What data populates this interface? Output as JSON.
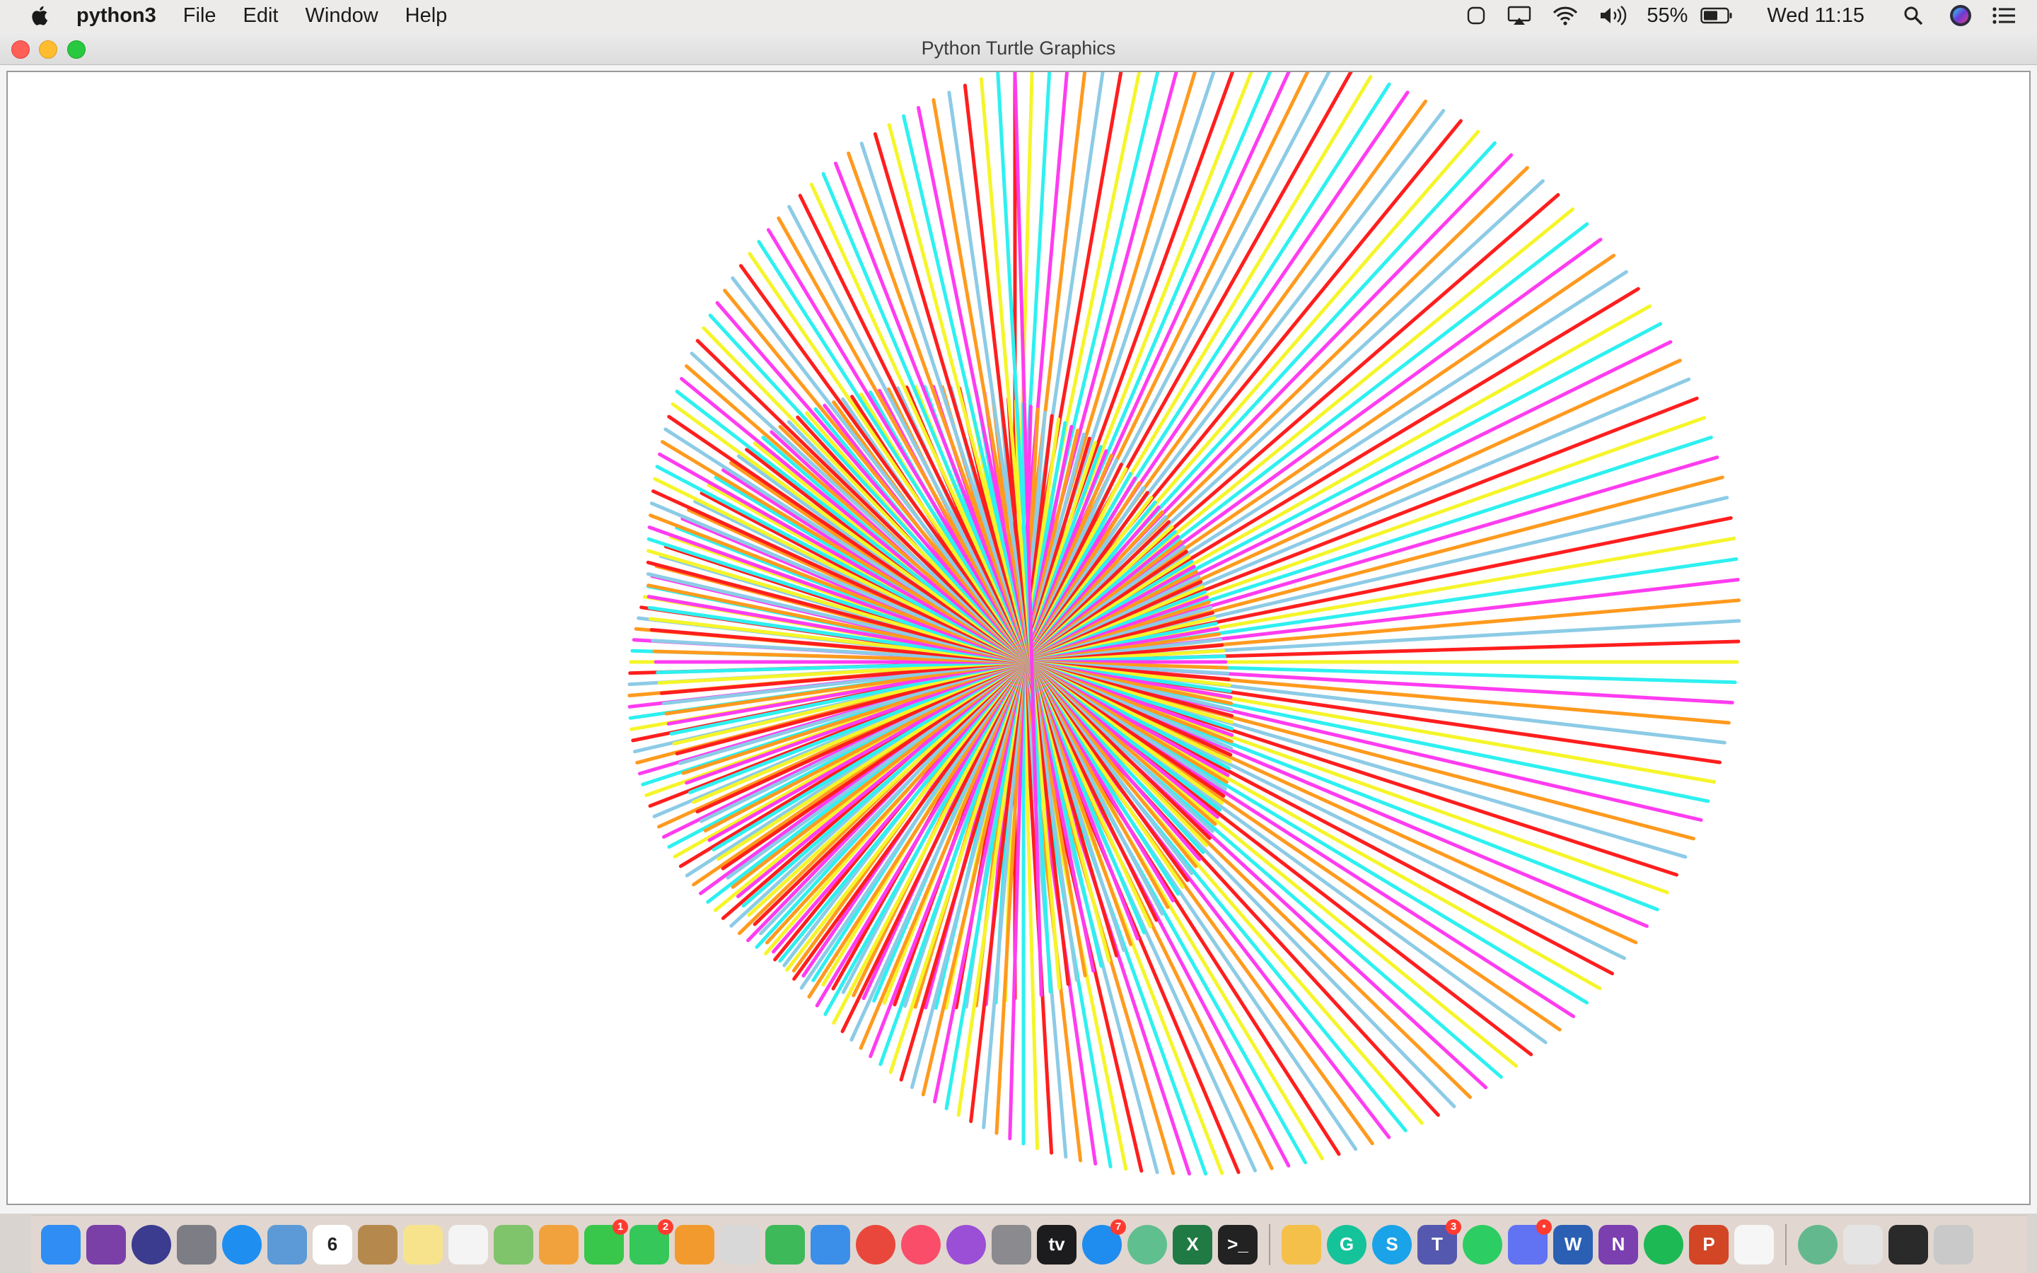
{
  "menubar": {
    "app_name": "python3",
    "menus": [
      "File",
      "Edit",
      "Window",
      "Help"
    ],
    "battery_percent": "55%",
    "clock": "Wed 11:15",
    "status_icons": [
      "screen-record-icon",
      "airplay-icon",
      "wifi-icon",
      "volume-icon",
      "battery-icon",
      "spotlight-search-icon",
      "siri-icon",
      "notification-center-icon"
    ]
  },
  "window": {
    "title": "Python Turtle Graphics"
  },
  "drawing": {
    "description_colors": [
      "#ff1e1e",
      "#f5f52a",
      "#2ef0f0",
      "#ff3cf0",
      "#ff9a1e",
      "#8ccbe6"
    ],
    "background": "#ffffff"
  },
  "dock": {
    "items": [
      {
        "name": "finder-icon",
        "color": "#2f8df3",
        "label": ""
      },
      {
        "name": "github-desktop-icon",
        "color": "#7b3fa8",
        "label": ""
      },
      {
        "name": "siri-app-icon",
        "color": "#3b3b8f",
        "label": ""
      },
      {
        "name": "launchpad-icon",
        "color": "#7d7d85",
        "label": ""
      },
      {
        "name": "safari-icon",
        "color": "#1e8ff0",
        "label": ""
      },
      {
        "name": "mail-icon",
        "color": "#5b9ad6",
        "label": ""
      },
      {
        "name": "calendar-icon",
        "color": "#ffffff",
        "label": "6"
      },
      {
        "name": "contacts-icon",
        "color": "#b5894e",
        "label": ""
      },
      {
        "name": "notes-icon",
        "color": "#f7e38b",
        "label": ""
      },
      {
        "name": "reminders-icon",
        "color": "#f4f4f4",
        "label": ""
      },
      {
        "name": "maps-icon",
        "color": "#7fc36a",
        "label": ""
      },
      {
        "name": "photos-icon",
        "color": "#f2a23c",
        "label": ""
      },
      {
        "name": "messages-icon",
        "color": "#39c74b",
        "label": "",
        "badge": "1"
      },
      {
        "name": "facetime-icon",
        "color": "#35c759",
        "label": "",
        "badge": "2"
      },
      {
        "name": "pages-icon",
        "color": "#f29a2e",
        "label": ""
      },
      {
        "name": "screenshot-icon",
        "color": "#d8d8d8",
        "label": ""
      },
      {
        "name": "numbers-icon",
        "color": "#3db95a",
        "label": ""
      },
      {
        "name": "keynote-icon",
        "color": "#3b8fe8",
        "label": ""
      },
      {
        "name": "chrome-icon",
        "color": "#e9473b",
        "label": ""
      },
      {
        "name": "music-icon",
        "color": "#fa4d6a",
        "label": ""
      },
      {
        "name": "podcasts-icon",
        "color": "#9b4fd6",
        "label": ""
      },
      {
        "name": "system-preferences-icon",
        "color": "#8a8a8f",
        "label": ""
      },
      {
        "name": "apple-tv-icon",
        "color": "#1c1c1e",
        "label": "tv"
      },
      {
        "name": "app-store-icon",
        "color": "#1f8cf0",
        "label": "",
        "badge": "7"
      },
      {
        "name": "atom-icon",
        "color": "#5fbf8f",
        "label": ""
      },
      {
        "name": "excel-icon",
        "color": "#1f7a43",
        "label": "X"
      },
      {
        "name": "terminal-icon",
        "color": "#222222",
        "label": ">_"
      },
      {
        "name": "sketch-icon",
        "color": "#f5c04a",
        "label": ""
      },
      {
        "name": "grammarly-icon",
        "color": "#15c39a",
        "label": "G"
      },
      {
        "name": "skype-icon",
        "color": "#1aa3e8",
        "label": "S"
      },
      {
        "name": "teams-icon",
        "color": "#5558af",
        "label": "T",
        "badge": "3"
      },
      {
        "name": "whatsapp-icon",
        "color": "#2ccd63",
        "label": ""
      },
      {
        "name": "discord-icon",
        "color": "#6172f3",
        "label": "",
        "badge": "•"
      },
      {
        "name": "word-icon",
        "color": "#2b5fb4",
        "label": "W"
      },
      {
        "name": "onenote-icon",
        "color": "#7b3fb0",
        "label": "N"
      },
      {
        "name": "spotify-icon",
        "color": "#1db954",
        "label": ""
      },
      {
        "name": "powerpoint-icon",
        "color": "#d24625",
        "label": "P"
      },
      {
        "name": "document-icon",
        "color": "#f6f6f6",
        "label": ""
      },
      {
        "name": "python-launcher-icon",
        "color": "#63b98d",
        "label": ""
      },
      {
        "name": "window-preview-icon",
        "color": "#e4e4e4",
        "label": ""
      },
      {
        "name": "terminal-window-icon",
        "color": "#2a2a2a",
        "label": ""
      },
      {
        "name": "trash-icon",
        "color": "#c9c9c9",
        "label": ""
      }
    ]
  }
}
